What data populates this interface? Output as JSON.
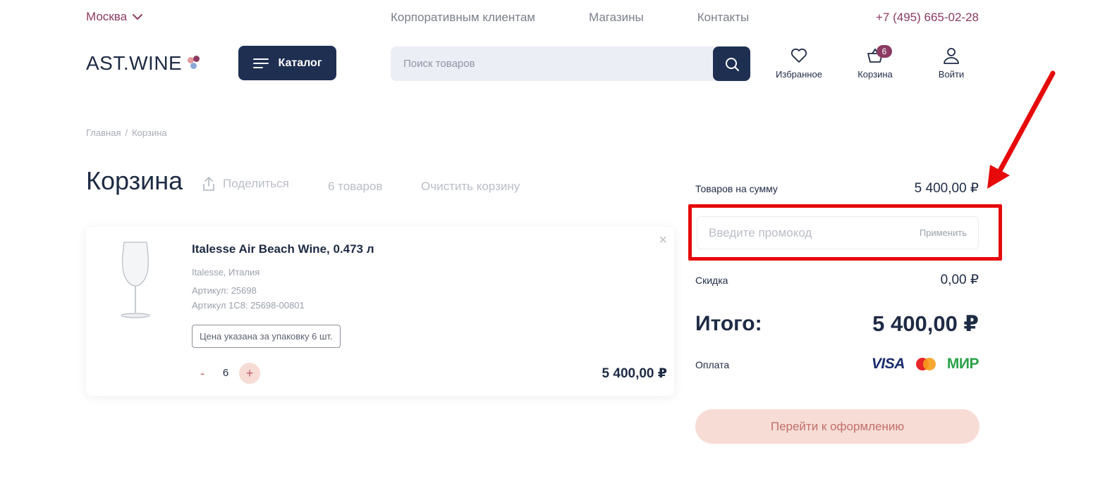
{
  "topbar": {
    "city": "Москва",
    "nav": [
      "Корпоративным клиентам",
      "Магазины",
      "Контакты"
    ],
    "phone": "+7 (495) 665-02-28"
  },
  "header": {
    "logo": "AST.WINE",
    "catalog_label": "Каталог",
    "search_placeholder": "Поиск товаров",
    "favorites_label": "Избранное",
    "cart_label": "Корзина",
    "cart_count": "6",
    "login_label": "Войти"
  },
  "breadcrumb": {
    "home": "Главная",
    "separator": "/",
    "current": "Корзина"
  },
  "cart": {
    "title": "Корзина",
    "share_label": "Поделиться",
    "items_count": "6 товаров",
    "clear_label": "Очистить корзину"
  },
  "product": {
    "title": "Italesse Air Beach Wine, 0.473 л",
    "brand_country": "Italesse, Италия",
    "article": "Артикул: 25698",
    "article_1c": "Артикул 1С8: 25698-00801",
    "pack_note": "Цена указана за упаковку 6 шт.",
    "quantity": "6",
    "minus": "-",
    "plus": "+",
    "price": "5 400,00 ₽",
    "remove": "×"
  },
  "summary": {
    "subtotal_label": "Товаров на сумму",
    "subtotal_value": "5 400,00 ₽",
    "promo_placeholder": "Введите промокод",
    "promo_apply": "Применить",
    "discount_label": "Скидка",
    "discount_value": "0,00 ₽",
    "total_label": "Итого:",
    "total_value": "5 400,00 ₽",
    "payment_label": "Оплата",
    "payment_visa": "VISA",
    "payment_mir": "МИР",
    "checkout_label": "Перейти к оформлению"
  },
  "colors": {
    "navy": "#1e2f52",
    "accent": "#8c3a62",
    "peach": "#f7dcd5",
    "annotation": "#e60a0a"
  }
}
